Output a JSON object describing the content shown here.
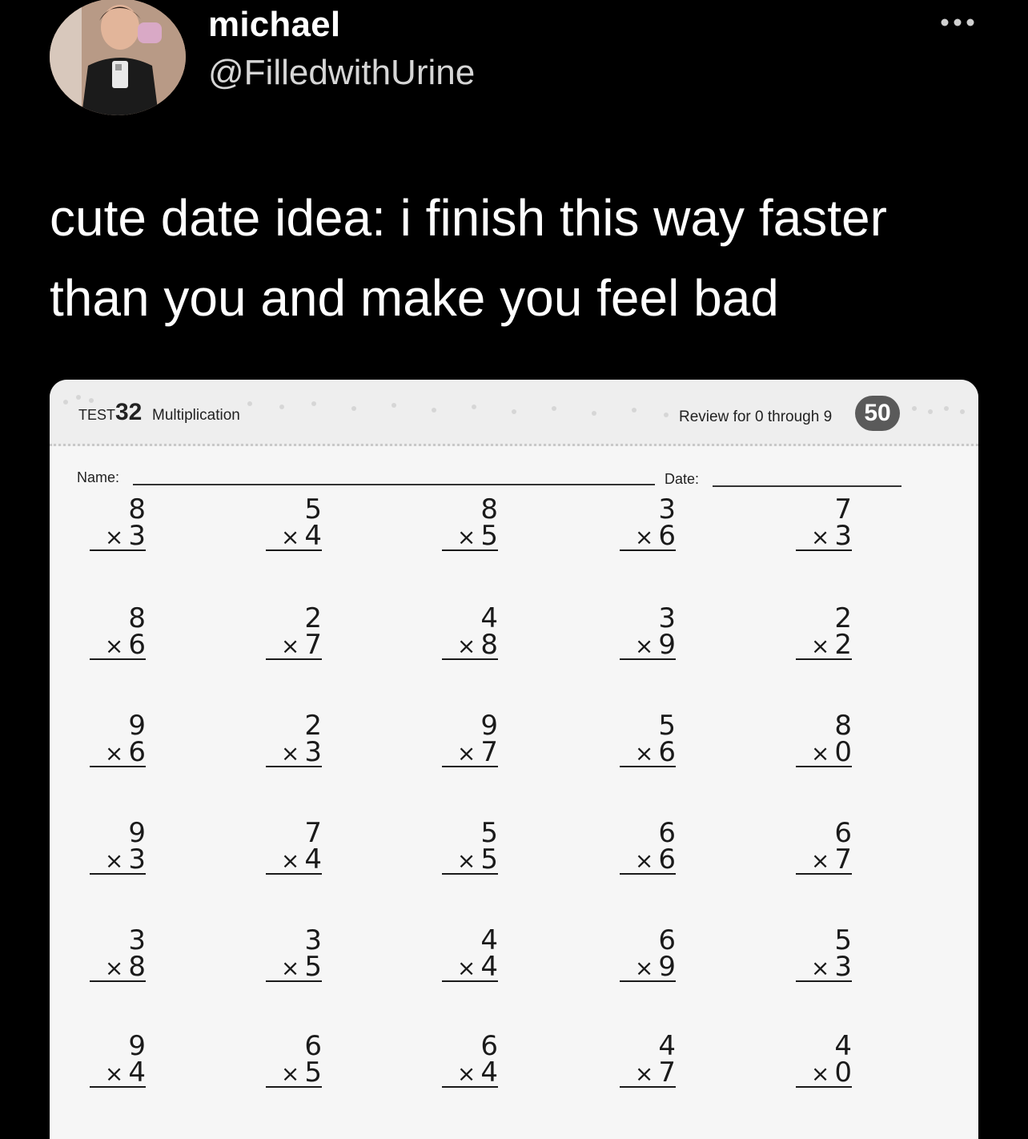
{
  "tweet": {
    "display_name": "michael",
    "handle": "@FilledwithUrine",
    "text": "cute date idea: i finish this way faster than you and make you feel bad",
    "more_icon": "more-horizontal-icon"
  },
  "worksheet": {
    "test_label": "TEST",
    "test_number": "32",
    "topic": "Multiplication",
    "review_label": "Review for 0 through 9",
    "score": "50",
    "name_label": "Name:",
    "date_label": "Date:",
    "problems": [
      [
        {
          "top": "8",
          "bottom": "3"
        },
        {
          "top": "5",
          "bottom": "4"
        },
        {
          "top": "8",
          "bottom": "5"
        },
        {
          "top": "3",
          "bottom": "6"
        },
        {
          "top": "7",
          "bottom": "3"
        }
      ],
      [
        {
          "top": "8",
          "bottom": "6"
        },
        {
          "top": "2",
          "bottom": "7"
        },
        {
          "top": "4",
          "bottom": "8"
        },
        {
          "top": "3",
          "bottom": "9"
        },
        {
          "top": "2",
          "bottom": "2"
        }
      ],
      [
        {
          "top": "9",
          "bottom": "6"
        },
        {
          "top": "2",
          "bottom": "3"
        },
        {
          "top": "9",
          "bottom": "7"
        },
        {
          "top": "5",
          "bottom": "6"
        },
        {
          "top": "8",
          "bottom": "0"
        }
      ],
      [
        {
          "top": "9",
          "bottom": "3"
        },
        {
          "top": "7",
          "bottom": "4"
        },
        {
          "top": "5",
          "bottom": "5"
        },
        {
          "top": "6",
          "bottom": "6"
        },
        {
          "top": "6",
          "bottom": "7"
        }
      ],
      [
        {
          "top": "3",
          "bottom": "8"
        },
        {
          "top": "3",
          "bottom": "5"
        },
        {
          "top": "4",
          "bottom": "4"
        },
        {
          "top": "6",
          "bottom": "9"
        },
        {
          "top": "5",
          "bottom": "3"
        }
      ],
      [
        {
          "top": "9",
          "bottom": "4"
        },
        {
          "top": "6",
          "bottom": "5"
        },
        {
          "top": "6",
          "bottom": "4"
        },
        {
          "top": "4",
          "bottom": "7"
        },
        {
          "top": "4",
          "bottom": "0"
        }
      ]
    ]
  }
}
